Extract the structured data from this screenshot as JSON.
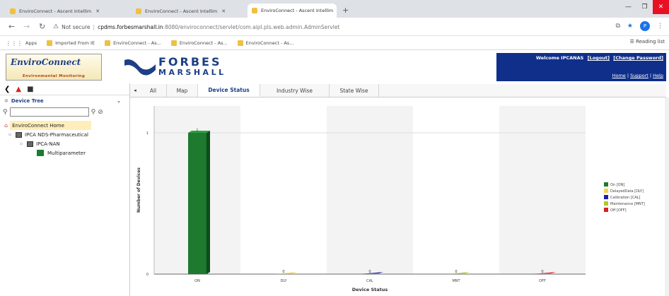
{
  "browser": {
    "tabs": [
      {
        "label": "EnviroConnect - Ascent Intellim"
      },
      {
        "label": "EnviroConnect - Ascent Intellim"
      },
      {
        "label": "EnviroConnect - Ascent Intellim"
      }
    ],
    "url_warning": "Not secure",
    "url_host": "cpdms.forbesmarshall.in",
    "url_path": ":8080/enviroconnect/servlet/com.aipl.pls.web.admin.AdminServlet",
    "profile_initial": "P",
    "bookmarks": [
      {
        "label": "Apps"
      },
      {
        "label": "Imported From IE"
      },
      {
        "label": "EnviroConnect - As..."
      },
      {
        "label": "EnviroConnect - As..."
      },
      {
        "label": "EnviroConnect - As..."
      }
    ],
    "reading_list": "Reading list"
  },
  "header": {
    "brand_name": "EnviroConnect",
    "brand_sub": "Environmental Monitoring",
    "logo_line1": "FORBES",
    "logo_line2": "MARSHALL",
    "welcome": "Welcome IPCANAS",
    "logout": "[Logout]",
    "change_password": "[Change Password]",
    "home": "Home",
    "support": "Support",
    "help": "Help",
    "sep": " | ",
    "brand_color": "#0f2f8a"
  },
  "sidebar": {
    "tree_title": "Device Tree",
    "search_placeholder": "",
    "nodes": [
      {
        "label": "EnviroConnect Home"
      },
      {
        "label": "IPCA NDS-Pharmaceutical"
      },
      {
        "label": "IPCA-NAN"
      },
      {
        "label": "Multiparameter"
      }
    ]
  },
  "main": {
    "tabs": [
      {
        "label": "All"
      },
      {
        "label": "Map"
      },
      {
        "label": "Device Status"
      },
      {
        "label": "Industry Wise"
      },
      {
        "label": "State Wise"
      }
    ]
  },
  "chart_data": {
    "type": "bar",
    "categories": [
      "ON",
      "DLY",
      "CAL",
      "MNT",
      "OFF"
    ],
    "values": [
      1,
      0,
      0,
      0,
      0
    ],
    "colors": [
      "#1e7a2e",
      "#f5d547",
      "#1f1fa8",
      "#a9cc29",
      "#d62020"
    ],
    "xlabel": "Device Status",
    "ylabel": "Number of Devices",
    "ylim": [
      0,
      1
    ],
    "yticks": [
      0,
      1
    ],
    "legend": [
      "On [ON]",
      "DelayedData [DLY]",
      "Calibration [CAL]",
      "Maintenance [MNT]",
      "Off [OFF]"
    ],
    "legend_position": "right"
  }
}
